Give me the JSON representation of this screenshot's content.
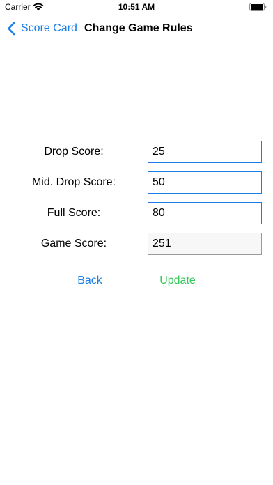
{
  "status_bar": {
    "carrier": "Carrier",
    "time": "10:51 AM",
    "wifi_icon": "wifi-icon",
    "battery_icon": "battery-icon"
  },
  "nav": {
    "back_label": "Score Card",
    "back_icon": "chevron-left-icon",
    "title": "Change Game Rules"
  },
  "form": {
    "drop_score": {
      "label": "Drop Score:",
      "value": "25"
    },
    "mid_drop_score": {
      "label": "Mid. Drop Score:",
      "value": "50"
    },
    "full_score": {
      "label": "Full Score:",
      "value": "80"
    },
    "game_score": {
      "label": "Game Score:",
      "value": "251"
    }
  },
  "actions": {
    "back_label": "Back",
    "update_label": "Update"
  },
  "colors": {
    "accent": "#1a7ee5",
    "update": "#34c759",
    "text": "#000000"
  }
}
